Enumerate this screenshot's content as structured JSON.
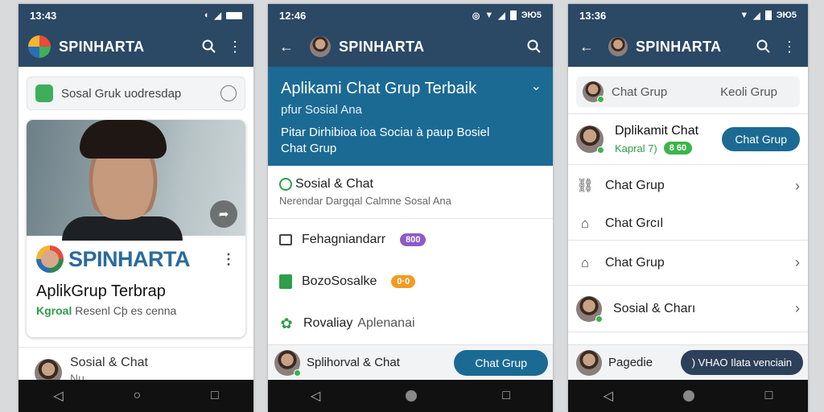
{
  "colors": {
    "header": "#2b4865",
    "accent_blue": "#1b6a94",
    "brand_text": "#2a6a9e",
    "green": "#2e9e4a",
    "purple_pill": "#8e59c9",
    "orange_pill": "#f29a22"
  },
  "phone1": {
    "time": "13:43",
    "app_title": "SPINHARTA",
    "search_placeholder": "Sosal Gruk uodresdap",
    "card": {
      "brand": "SPINHARTA",
      "title": "AplikGrup Terbrap",
      "sub_green": "Kgroal",
      "sub_rest": "Resenl Cþ es cenna"
    },
    "list_item": {
      "title": "Sosial & Chat",
      "sub": "Nu…"
    }
  },
  "phone2": {
    "time": "12:46",
    "status_extra": "ЭЮ5",
    "app_title": "SPINHARTA",
    "hero": {
      "title": "Aplikami Chat Grup Terbaik",
      "subtitle": "pfur Sosial Ana",
      "desc_line1": "Pitar Dirhibioa ioa Sociaı à paup Bosiel",
      "desc_line2": "Chat Grup"
    },
    "rows": [
      {
        "title": "Sosial & Chat",
        "sub": "Nerendar Dargqal Calmne Sosal Ana",
        "icon": "chat-bubble-icon"
      },
      {
        "title": "Fehagniandarr",
        "pill": "800",
        "pill_color": "#8e59c9",
        "icon": "square-icon"
      },
      {
        "title": "BozoSosalke",
        "pill": "0·0",
        "pill_color": "#f29a22",
        "icon": "document-icon"
      },
      {
        "title": "Rovaliay",
        "title_rest": "Aplenanai",
        "icon": "puzzle-icon"
      }
    ],
    "footer": {
      "label": "Splihorval & Chat",
      "button": "Chat Grup"
    }
  },
  "phone3": {
    "time": "13:36",
    "status_extra": "ЭЮ5",
    "app_title": "SPINHARTA",
    "chip": {
      "left": "Chat Grup",
      "right": "Keoli Grup"
    },
    "profile": {
      "name": "Dplikamit Chat",
      "sub": "Kapral 7)",
      "badge": "8 60",
      "button": "Chat Grup"
    },
    "rows": [
      {
        "title": "Chat Grup",
        "icon": "link-icon",
        "chevron": true
      },
      {
        "title": "Chat Grcıl",
        "icon": "bag-icon",
        "chevron": false
      },
      {
        "title": "Chat Grup",
        "icon": "home-icon",
        "chevron": true
      },
      {
        "title": "Sosial & Charı",
        "icon": "avatar",
        "chevron": true
      }
    ],
    "footer": {
      "label": "Pagedie",
      "button": ") VHAO Ilata venciain"
    }
  }
}
